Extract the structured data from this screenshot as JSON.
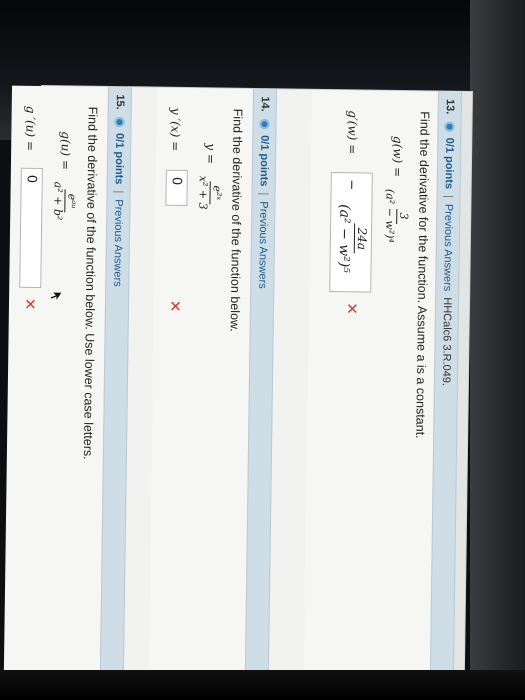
{
  "questions": [
    {
      "number": "13.",
      "points": "0/1 points",
      "sep": "|",
      "link": "Previous Answers",
      "source": "HHCalc6 3.R.049.",
      "prompt": "Find the derivative for the function. Assume a is a constant.",
      "function_lhs": "g(w) =",
      "function_num": "3",
      "function_den": "(a² − w²)⁴",
      "answer_lhs": "g′(w) =",
      "answer_sign": "−",
      "answer_num": "24a",
      "answer_den": "(a² − w²)⁵",
      "status_mark": "✕"
    },
    {
      "number": "14.",
      "points": "0/1 points",
      "sep": "|",
      "link": "Previous Answers",
      "prompt": "Find the derivative of the function below.",
      "function_lhs": "y =",
      "function_num": "e²ˣ",
      "function_den": "x² + 3",
      "answer_lhs": "y ′(x) =",
      "answer_value": "0",
      "status_mark": "✕"
    },
    {
      "number": "15.",
      "points": "0/1 points",
      "sep": "|",
      "link": "Previous Answers",
      "prompt": "Find the derivative of the function below. Use lower case letters.",
      "function_lhs": "g(u) =",
      "function_num": "eᵃᵘ",
      "function_den": "a² + b²",
      "answer_lhs": "g ′(u) =",
      "answer_value": "0",
      "status_mark": "✕"
    }
  ],
  "colors": {
    "header_bg": "#cfdde6",
    "link": "#1d5a90",
    "wrong": "#d8382c"
  }
}
